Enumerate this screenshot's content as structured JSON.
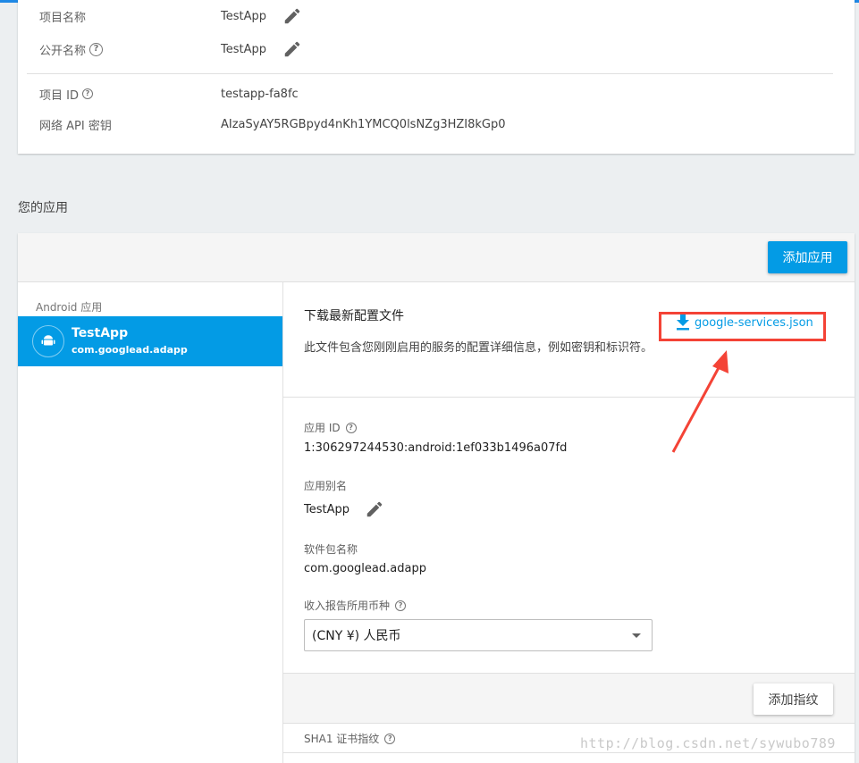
{
  "colors": {
    "accent": "#039be5",
    "top_line": "#1e88e5",
    "highlight": "#f44336"
  },
  "project": {
    "name_label": "项目名称",
    "name_value": "TestApp",
    "public_name_label": "公开名称",
    "public_name_value": "TestApp",
    "id_label": "项目 ID",
    "id_value": "testapp-fa8fc",
    "api_key_label": "网络 API 密钥",
    "api_key_value": "AIzaSyAY5RGBpyd4nKh1YMCQ0lsNZg3HZI8kGp0"
  },
  "apps_section_title": "您的应用",
  "add_app_label": "添加应用",
  "sidebar": {
    "heading": "Android 应用",
    "apps": [
      {
        "name": "TestApp",
        "package": "com.googlead.adapp"
      }
    ]
  },
  "detail": {
    "download_title": "下载最新配置文件",
    "download_desc": "此文件包含您刚刚启用的服务的配置详细信息，例如密钥和标识符。",
    "download_file": "google-services.json",
    "app_id_label": "应用 ID",
    "app_id_value": "1:306297244530:android:1ef033b1496a07fd",
    "nickname_label": "应用别名",
    "nickname_value": "TestApp",
    "package_label": "软件包名称",
    "package_value": "com.googlead.adapp",
    "currency_label": "收入报告所用币种",
    "currency_value": "(CNY ¥) 人民币",
    "add_fingerprint_label": "添加指纹",
    "sha1_label": "SHA1 证书指纹"
  },
  "watermark": "http://blog.csdn.net/sywubo789"
}
